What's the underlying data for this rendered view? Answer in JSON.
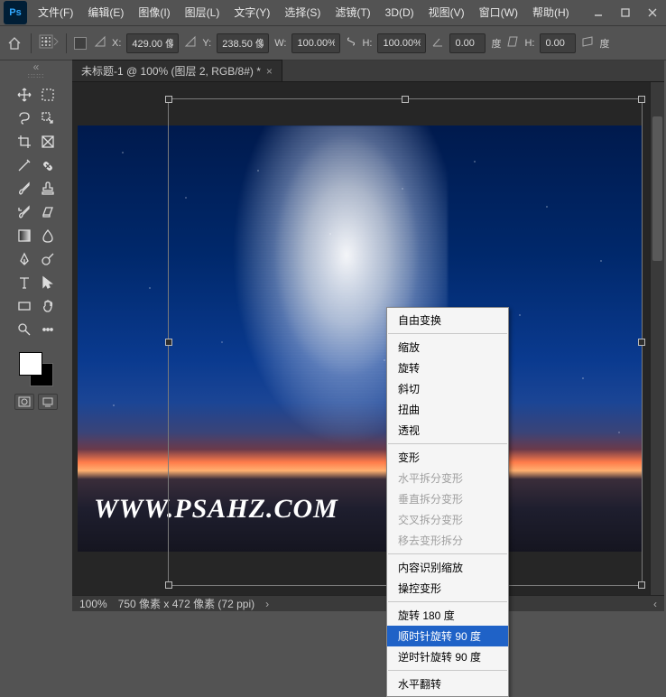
{
  "app": {
    "logo": "Ps"
  },
  "menu": [
    "文件(F)",
    "编辑(E)",
    "图像(I)",
    "图层(L)",
    "文字(Y)",
    "选择(S)",
    "滤镜(T)",
    "3D(D)",
    "视图(V)",
    "窗口(W)",
    "帮助(H)"
  ],
  "options": {
    "x_label": "X:",
    "x_value": "429.00 像",
    "y_label": "Y:",
    "y_value": "238.50 像",
    "w_label": "W:",
    "w_value": "100.00%",
    "h_label": "H:",
    "h_value": "100.00%",
    "angle_value": "0.00",
    "angle_suffix": "度",
    "skew_label": "H:",
    "skew_value": "0.00",
    "skew_suffix": "度"
  },
  "tab": {
    "title": "未标题-1 @ 100% (图层 2, RGB/8#) *"
  },
  "status": {
    "zoom": "100%",
    "dims": "750 像素 x 472 像素 (72 ppi)"
  },
  "watermark": "WWW.PSAHZ.COM",
  "context": {
    "items": [
      {
        "label": "自由变换",
        "type": "item"
      },
      {
        "type": "sep"
      },
      {
        "label": "缩放",
        "type": "item"
      },
      {
        "label": "旋转",
        "type": "item"
      },
      {
        "label": "斜切",
        "type": "item"
      },
      {
        "label": "扭曲",
        "type": "item"
      },
      {
        "label": "透视",
        "type": "item"
      },
      {
        "type": "sep"
      },
      {
        "label": "变形",
        "type": "item"
      },
      {
        "label": "水平拆分变形",
        "type": "disabled"
      },
      {
        "label": "垂直拆分变形",
        "type": "disabled"
      },
      {
        "label": "交叉拆分变形",
        "type": "disabled"
      },
      {
        "label": "移去变形拆分",
        "type": "disabled"
      },
      {
        "type": "sep"
      },
      {
        "label": "内容识别缩放",
        "type": "item"
      },
      {
        "label": "操控变形",
        "type": "item"
      },
      {
        "type": "sep"
      },
      {
        "label": "旋转 180 度",
        "type": "item"
      },
      {
        "label": "顺时针旋转 90 度",
        "type": "selected"
      },
      {
        "label": "逆时针旋转 90 度",
        "type": "item"
      },
      {
        "type": "sep"
      },
      {
        "label": "水平翻转",
        "type": "item"
      }
    ]
  }
}
